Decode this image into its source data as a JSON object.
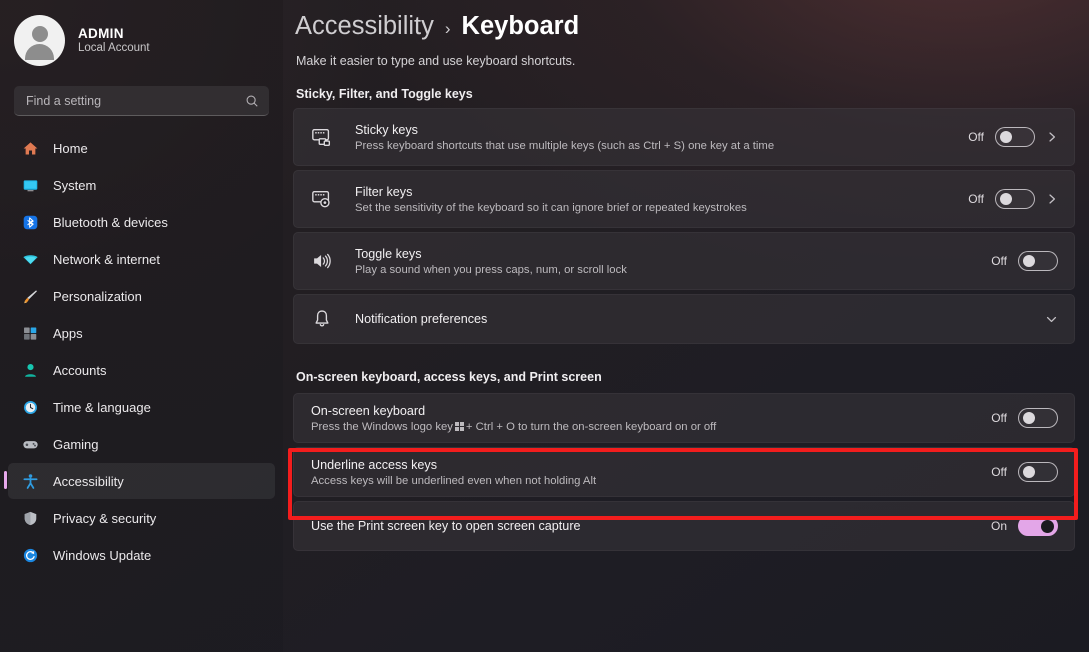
{
  "sidebar": {
    "profile": {
      "name": "ADMIN",
      "account_type": "Local Account",
      "avatar_icon": "person-avatar-icon"
    },
    "search": {
      "placeholder": "Find a setting",
      "value": "",
      "icon": "search-icon"
    },
    "items": [
      {
        "label": "Home",
        "icon": "home-icon",
        "selected": false
      },
      {
        "label": "System",
        "icon": "system-display-icon",
        "selected": false
      },
      {
        "label": "Bluetooth & devices",
        "icon": "bluetooth-icon",
        "selected": false
      },
      {
        "label": "Network & internet",
        "icon": "wifi-icon",
        "selected": false
      },
      {
        "label": "Personalization",
        "icon": "paintbrush-icon",
        "selected": false
      },
      {
        "label": "Apps",
        "icon": "apps-grid-icon",
        "selected": false
      },
      {
        "label": "Accounts",
        "icon": "account-person-icon",
        "selected": false
      },
      {
        "label": "Time & language",
        "icon": "clock-icon",
        "selected": false
      },
      {
        "label": "Gaming",
        "icon": "gamepad-icon",
        "selected": false
      },
      {
        "label": "Accessibility",
        "icon": "accessibility-person-icon",
        "selected": true
      },
      {
        "label": "Privacy & security",
        "icon": "shield-icon",
        "selected": false
      },
      {
        "label": "Windows Update",
        "icon": "update-refresh-icon",
        "selected": false
      }
    ]
  },
  "header": {
    "breadcrumb_parent": "Accessibility",
    "breadcrumb_separator": "›",
    "breadcrumb_current": "Keyboard",
    "subtitle": "Make it easier to type and use keyboard shortcuts."
  },
  "sections": [
    {
      "title": "Sticky, Filter, and Toggle keys",
      "rows": [
        {
          "name": "sticky-keys",
          "icon": "keyboard-sticky-keys-icon",
          "title": "Sticky keys",
          "description": "Press keyboard shortcuts that use multiple keys (such as Ctrl + S) one key at a time",
          "state_label": "Off",
          "toggle_on": false,
          "has_chevron": true,
          "chevron_icon": "chevron-right-icon"
        },
        {
          "name": "filter-keys",
          "icon": "keyboard-filter-keys-icon",
          "title": "Filter keys",
          "description": "Set the sensitivity of the keyboard so it can ignore brief or repeated keystrokes",
          "state_label": "Off",
          "toggle_on": false,
          "has_chevron": true,
          "chevron_icon": "chevron-right-icon"
        },
        {
          "name": "toggle-keys",
          "icon": "speaker-sound-icon",
          "title": "Toggle keys",
          "description": "Play a sound when you press caps, num, or scroll lock",
          "state_label": "Off",
          "toggle_on": false,
          "has_chevron": false,
          "chevron_icon": ""
        },
        {
          "name": "notification-preferences",
          "icon": "bell-notification-icon",
          "title": "Notification preferences",
          "description": "",
          "state_label": "",
          "toggle_on": null,
          "has_chevron": false,
          "chevron_icon": "chevron-down-icon"
        }
      ]
    },
    {
      "title": "On-screen keyboard, access keys, and Print screen",
      "rows": [
        {
          "name": "on-screen-keyboard",
          "icon": "",
          "title": "On-screen keyboard",
          "description_before_winkey": "Press the Windows logo key",
          "description_after_winkey": "+ Ctrl + O to turn the on-screen keyboard on or off",
          "state_label": "Off",
          "toggle_on": false,
          "highlighted": true
        },
        {
          "name": "underline-access-keys",
          "icon": "",
          "title": "Underline access keys",
          "description": "Access keys will be underlined even when not holding Alt",
          "state_label": "Off",
          "toggle_on": false
        },
        {
          "name": "print-screen-capture",
          "icon": "",
          "title": "Use the Print screen key to open screen capture",
          "description": "",
          "state_label": "On",
          "toggle_on": true
        }
      ]
    }
  ],
  "colors": {
    "accent": "#e3a6e8",
    "highlight_box": "#f31d1d",
    "card_bg": "#38353a",
    "text_primary": "#f2f0f2",
    "text_secondary": "#bdbabe"
  }
}
